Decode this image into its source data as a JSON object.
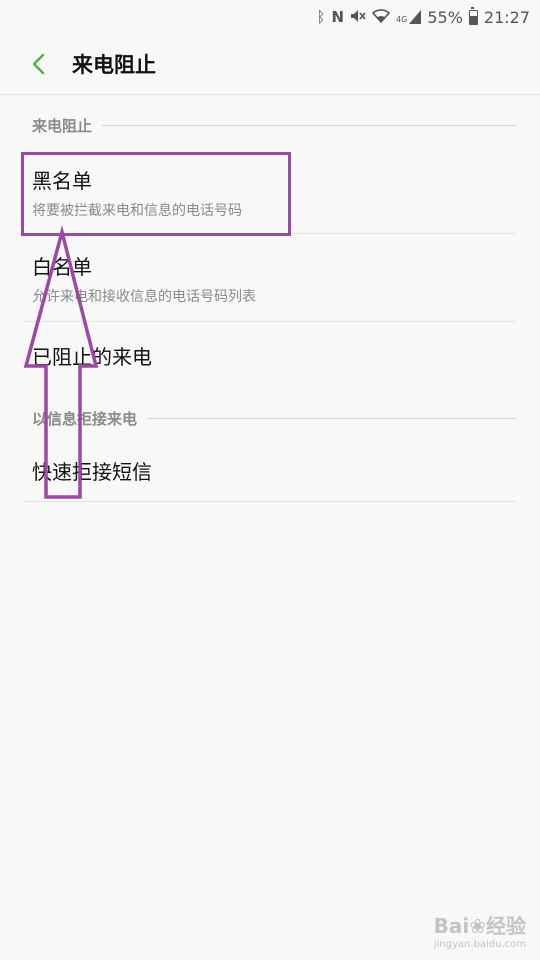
{
  "status_bar": {
    "icons": [
      "bluetooth-icon",
      "nfc-icon",
      "mute-icon",
      "wifi-icon",
      "signal-icon"
    ],
    "signal_label": "4G",
    "battery": "55%",
    "time": "21:27"
  },
  "app_bar": {
    "back_icon": "chevron-left-icon",
    "title": "来电阻止"
  },
  "sections": [
    {
      "header": "来电阻止",
      "items": [
        {
          "label": "黑名单",
          "description": "将要被拦截来电和信息的电话号码"
        },
        {
          "label": "白名单",
          "description": "允许来电和接收信息的电话号码列表"
        },
        {
          "label": "已阻止的来电"
        }
      ]
    },
    {
      "header": "以信息拒接来电",
      "items": [
        {
          "label": "快速拒接短信"
        }
      ]
    }
  ],
  "colors": {
    "accent": "#4caf50",
    "annotation": "#9b4aa3",
    "background": "#f8f8f8"
  },
  "watermark": {
    "brand": "Bai",
    "brand_cn": "经验",
    "url": "jingyan.baidu.com"
  }
}
